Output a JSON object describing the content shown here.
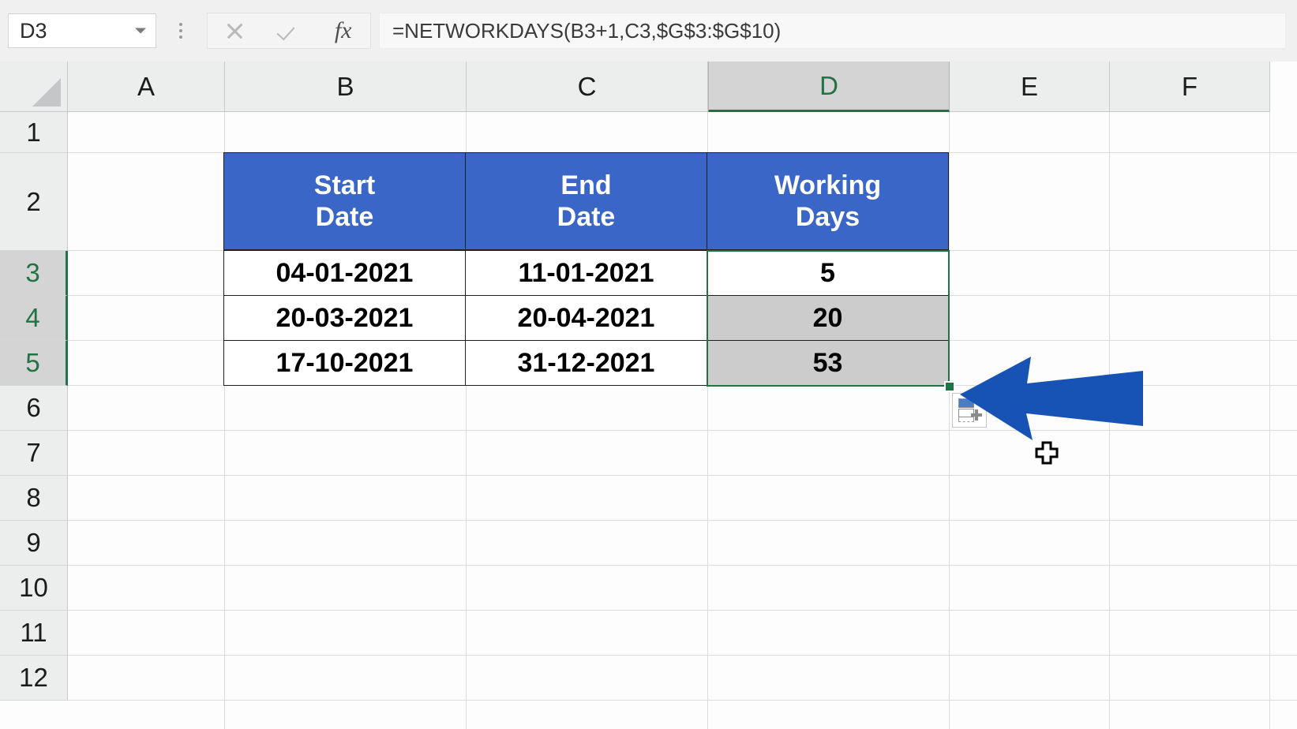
{
  "formula_bar": {
    "name_box_value": "D3",
    "name_box_dropdown_icon": "chevron-down-icon",
    "cancel_icon": "close-x-icon",
    "confirm_icon": "check-icon",
    "function_icon": "fx-insert-function-icon",
    "formula_value": "=NETWORKDAYS(B3+1,C3,$G$3:$G$10)",
    "formula_placeholder": ""
  },
  "grid": {
    "column_headers": [
      "A",
      "B",
      "C",
      "D",
      "E",
      "F"
    ],
    "selected_column": "D",
    "row_headers": [
      "1",
      "2",
      "3",
      "4",
      "5",
      "6",
      "7",
      "8",
      "9",
      "10",
      "11",
      "12"
    ],
    "selected_rows": [
      "3",
      "4",
      "5"
    ],
    "select_all_icon": "select-all-corner-icon"
  },
  "table": {
    "headers": [
      "Start\nDate",
      "End\nDate",
      "Working\nDays"
    ],
    "header_lines": [
      [
        "Start",
        "Date"
      ],
      [
        "End",
        "Date"
      ],
      [
        "Working",
        "Days"
      ]
    ],
    "rows": [
      {
        "start_date": "04-01-2021",
        "end_date": "11-01-2021",
        "working_days": "5"
      },
      {
        "start_date": "20-03-2021",
        "end_date": "20-04-2021",
        "working_days": "20"
      },
      {
        "start_date": "17-10-2021",
        "end_date": "31-12-2021",
        "working_days": "53"
      }
    ]
  },
  "selection": {
    "range": "D3:D5",
    "active_cell": "D3",
    "fill_handle_icon": "fill-handle-square-icon",
    "autofill_options_icon": "autofill-options-icon"
  },
  "annotation": {
    "arrow_icon": "left-pointing-arrow-icon",
    "cursor_icon": "cross-cell-cursor-icon"
  },
  "colors": {
    "table_header_blue": "#3A66C7",
    "annotation_arrow_blue": "#1752B5",
    "selection_green": "#217346",
    "selected_cell_gray": "#CCCCCC",
    "header_gray": "#ECEDED",
    "selected_header_gray": "#D4D4D4",
    "gridline_gray": "#DCDCDC"
  }
}
